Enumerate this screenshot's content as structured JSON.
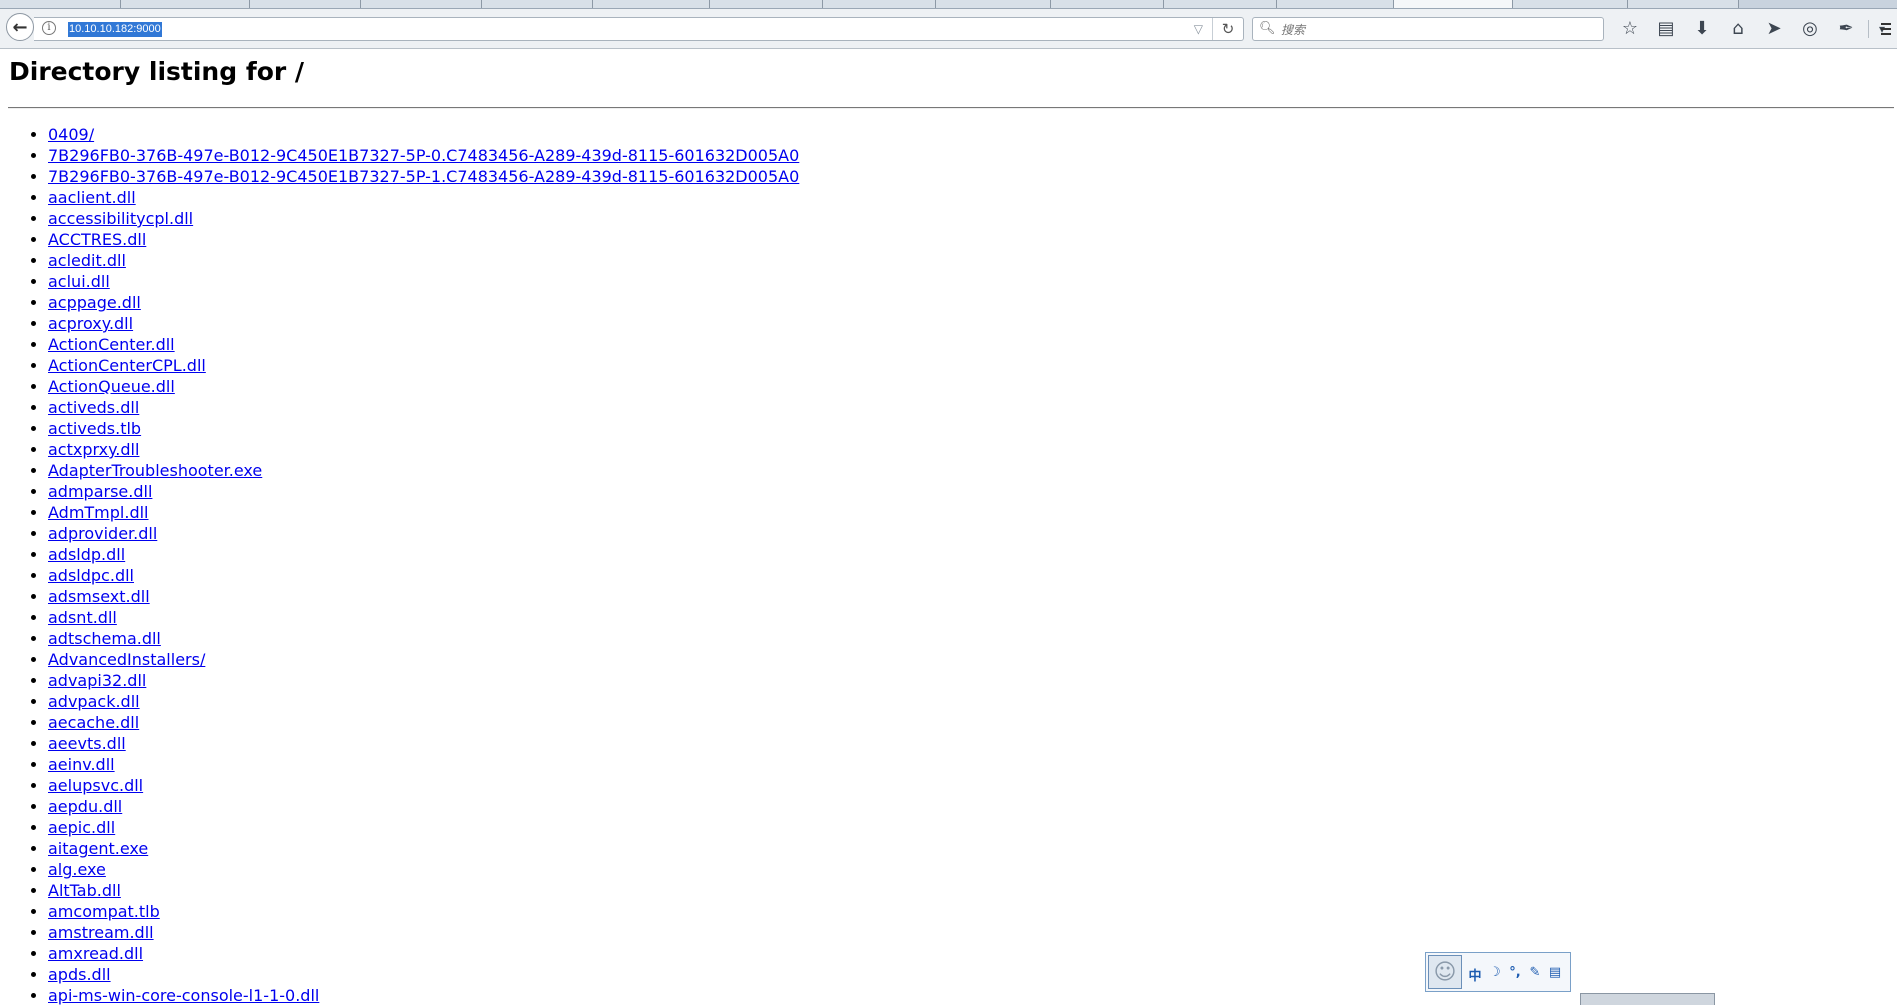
{
  "browser": {
    "url": "10.10.10.182:9000",
    "search_placeholder": "搜索",
    "icons": [
      "back-arrow-icon",
      "info-icon",
      "dropdown-arrow-icon",
      "reload-icon",
      "search-icon",
      "bookmark-star-icon",
      "reading-list-icon",
      "download-icon",
      "home-icon",
      "send-icon",
      "pocket-icon",
      "extension-icon",
      "overflow-icon",
      "hamburger-menu-icon"
    ]
  },
  "page": {
    "title": "Directory listing for /",
    "entries": [
      "0409/",
      "7B296FB0-376B-497e-B012-9C450E1B7327-5P-0.C7483456-A289-439d-8115-601632D005A0",
      "7B296FB0-376B-497e-B012-9C450E1B7327-5P-1.C7483456-A289-439d-8115-601632D005A0",
      "aaclient.dll",
      "accessibilitycpl.dll",
      "ACCTRES.dll",
      "acledit.dll",
      "aclui.dll",
      "acppage.dll",
      "acproxy.dll",
      "ActionCenter.dll",
      "ActionCenterCPL.dll",
      "ActionQueue.dll",
      "activeds.dll",
      "activeds.tlb",
      "actxprxy.dll",
      "AdapterTroubleshooter.exe",
      "admparse.dll",
      "AdmTmpl.dll",
      "adprovider.dll",
      "adsldp.dll",
      "adsldpc.dll",
      "adsmsext.dll",
      "adsnt.dll",
      "adtschema.dll",
      "AdvancedInstallers/",
      "advapi32.dll",
      "advpack.dll",
      "aecache.dll",
      "aeevts.dll",
      "aeinv.dll",
      "aelupsvc.dll",
      "aepdu.dll",
      "aepic.dll",
      "aitagent.exe",
      "alg.exe",
      "AltTab.dll",
      "amcompat.tlb",
      "amstream.dll",
      "amxread.dll",
      "apds.dll",
      "api-ms-win-core-console-l1-1-0.dll"
    ]
  },
  "ime": {
    "items": [
      "中",
      "☽",
      "°,",
      "✎",
      "▤"
    ]
  }
}
